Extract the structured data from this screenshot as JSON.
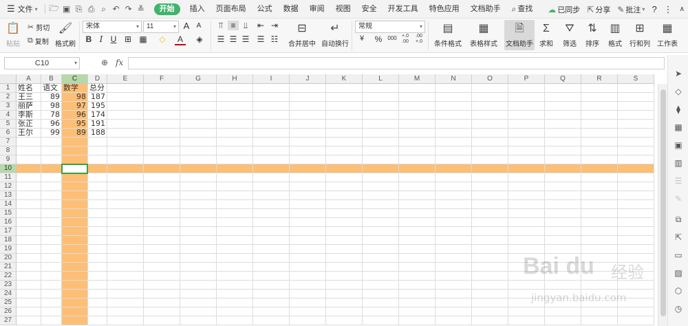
{
  "menubar": {
    "file_label": "文件",
    "tabs": [
      "开始",
      "插入",
      "页面布局",
      "公式",
      "数据",
      "审阅",
      "视图",
      "安全",
      "开发工具",
      "特色应用",
      "文档助手"
    ],
    "active_tab": "开始",
    "search_label": "查找",
    "right": {
      "sync": "已同步",
      "share": "分享",
      "comment": "批注"
    }
  },
  "ribbon": {
    "paste": "粘贴",
    "cut": "剪切",
    "copy": "复制",
    "format_painter": "格式刷",
    "font_name": "宋体",
    "font_size": "11",
    "number_format": "常规",
    "merge_center": "合并居中",
    "wrap_text": "自动换行",
    "cond_format": "条件格式",
    "table_style": "表格样式",
    "doc_assistant": "文档助手",
    "sum": "求和",
    "filter": "筛选",
    "sort": "排序",
    "format": "格式",
    "rows_cols": "行和列",
    "worksheet": "工作表",
    "percent": "%",
    "thousands": "000",
    "inc_decimal": "+.0 .00",
    "dec_decimal": ".00 +.0",
    "bold": "B",
    "italic": "I",
    "underline": "U",
    "font_color": "A",
    "grow_font": "A",
    "shrink_font": "A"
  },
  "formula_bar": {
    "name_box": "C10",
    "fx_label": "fx",
    "formula": ""
  },
  "sheet": {
    "columns": [
      "A",
      "B",
      "C",
      "D",
      "E",
      "F",
      "G",
      "H",
      "I",
      "J",
      "K",
      "L",
      "M",
      "N",
      "O",
      "P",
      "Q",
      "R",
      "S"
    ],
    "rows": [
      "1",
      "2",
      "3",
      "4",
      "5",
      "6",
      "7",
      "8",
      "9",
      "10",
      "11",
      "12",
      "13",
      "14",
      "15",
      "16",
      "17",
      "18",
      "19",
      "20",
      "21",
      "22",
      "23",
      "24",
      "25",
      "26",
      "27"
    ],
    "selected_column": "C",
    "selected_row": "10",
    "active_cell": "C10",
    "highlight_color": "#FDBF75",
    "data": [
      [
        "姓名",
        "语文",
        "数学",
        "总分"
      ],
      [
        "王三",
        "89",
        "98",
        "187"
      ],
      [
        "丽萨",
        "98",
        "97",
        "195"
      ],
      [
        "李斯",
        "78",
        "96",
        "174"
      ],
      [
        "张正",
        "96",
        "95",
        "191"
      ],
      [
        "王尔",
        "99",
        "89",
        "188"
      ]
    ]
  },
  "watermark": {
    "brand": "Bai du",
    "cn": "经验",
    "url": "jingyan.baidu.com"
  }
}
